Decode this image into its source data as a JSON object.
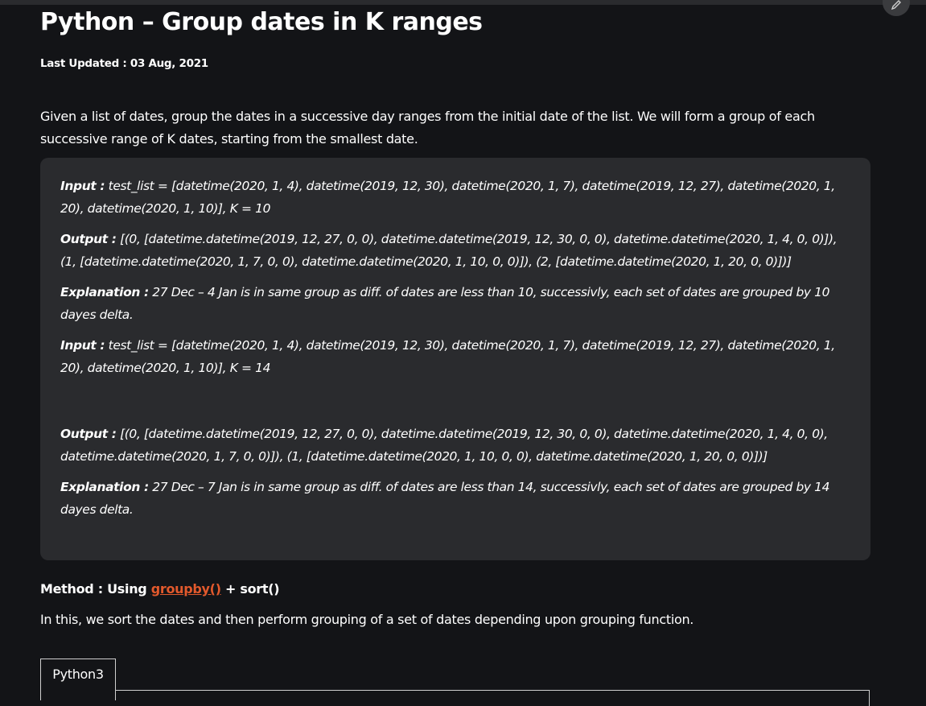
{
  "article": {
    "title": "Python – Group dates in K ranges",
    "last_updated": "Last Updated : 03 Aug, 2021",
    "intro": "Given a list of dates, group the dates in a successive day ranges from the initial date of the list. We will form a group of each successive range of K dates, starting from the smallest date."
  },
  "examples": {
    "input1_label": "Input :",
    "input1_text": " test_list = [datetime(2020, 1, 4), datetime(2019, 12, 30), datetime(2020, 1, 7), datetime(2019, 12, 27), datetime(2020, 1, 20), datetime(2020, 1, 10)], K = 10",
    "output1_label": "Output :",
    "output1_text": " [(0, [datetime.datetime(2019, 12, 27, 0, 0), datetime.datetime(2019, 12, 30, 0, 0), datetime.datetime(2020, 1, 4, 0, 0)]), (1, [datetime.datetime(2020, 1, 7, 0, 0), datetime.datetime(2020, 1, 10, 0, 0)]), (2, [datetime.datetime(2020, 1, 20, 0, 0)])]",
    "explanation1_label": "Explanation :",
    "explanation1_text": " 27 Dec – 4 Jan is in same group as diff. of dates are less than 10, successivly, each set of dates are grouped by 10 dayes delta.",
    "input2_label": "Input :",
    "input2_text": " test_list = [datetime(2020, 1, 4), datetime(2019, 12, 30), datetime(2020, 1, 7), datetime(2019, 12, 27), datetime(2020, 1, 20), datetime(2020, 1, 10)], K = 14",
    "output2_label": "Output :",
    "output2_text": " [(0, [datetime.datetime(2019, 12, 27, 0, 0), datetime.datetime(2019, 12, 30, 0, 0), datetime.datetime(2020, 1, 4, 0, 0), datetime.datetime(2020, 1, 7, 0, 0)]), (1, [datetime.datetime(2020, 1, 10, 0, 0), datetime.datetime(2020, 1, 20, 0, 0)])]",
    "explanation2_label": "Explanation :",
    "explanation2_text": " 27 Dec – 7 Jan is in same group as diff. of dates are less than 14, successivly, each set of dates are grouped by 14 dayes delta."
  },
  "method": {
    "prefix": "Method : Using ",
    "link": "groupby()",
    "suffix": " + sort()",
    "description": "In this, we sort the dates and then perform grouping of a set of dates depending upon grouping function."
  },
  "code": {
    "tab_label": "Python3"
  },
  "icons": {
    "edit": "pencil-icon"
  },
  "colors": {
    "background": "#131417",
    "example_box": "#2a2b2e",
    "link": "#e2592c"
  }
}
